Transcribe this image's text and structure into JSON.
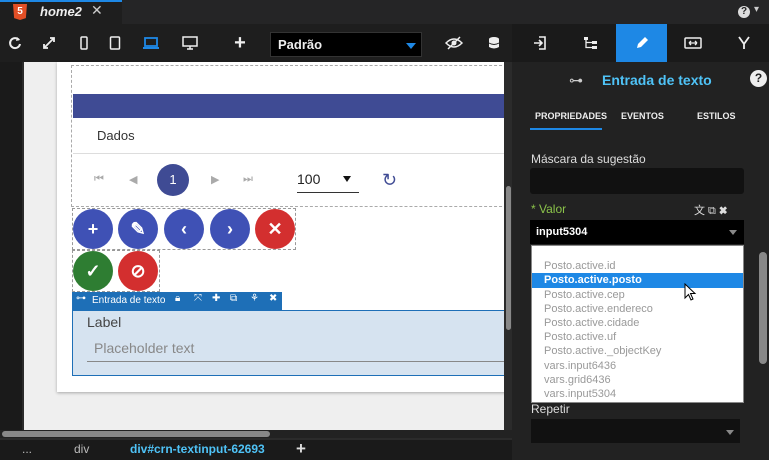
{
  "file_tab": {
    "icon_letter": "5",
    "name": "home2",
    "close": "✕"
  },
  "topbar": {
    "help": "?",
    "caret": "▾"
  },
  "toolbar": {
    "refresh": "⟳",
    "fullscreen": "⤢",
    "add": "+",
    "dropdown_value": "Padrão"
  },
  "canvas": {
    "tab_label": "Dados",
    "pagination": {
      "first": "⏮",
      "prev": "◀",
      "current": "1",
      "next": "▶",
      "last": "⏭",
      "per_page": "100",
      "refresh": "↻"
    },
    "fab_buttons": [
      {
        "name": "add",
        "glyph": "+",
        "color": "#3f51b5"
      },
      {
        "name": "edit",
        "glyph": "✎",
        "color": "#3f51b5"
      },
      {
        "name": "prev",
        "glyph": "‹",
        "color": "#3f51b5"
      },
      {
        "name": "next",
        "glyph": "›",
        "color": "#3f51b5"
      },
      {
        "name": "delete",
        "glyph": "✕",
        "color": "#d32f2f"
      },
      {
        "name": "confirm",
        "glyph": "✓",
        "color": "#2e7d32"
      },
      {
        "name": "cancel",
        "glyph": "⊘",
        "color": "#d32f2f"
      }
    ],
    "selected_component": {
      "label": "Entrada de texto"
    },
    "text_input": {
      "label": "Label",
      "placeholder": "Placeholder text"
    }
  },
  "breadcrumb": {
    "items": [
      "...",
      "div",
      "div#crn-textinput-62693"
    ],
    "add": "+"
  },
  "panel": {
    "title": "Entrada de texto",
    "help": "?",
    "subtabs": [
      "PROPRIEDADES",
      "EVENTOS",
      "ESTILOS"
    ],
    "mask_label": "Máscara da sugestão",
    "value_label": "* Valor",
    "value_icons": "文 ⧉ ✖",
    "value_selected": "input5304",
    "dropdown_options": [
      "Posto.active.id",
      "Posto.active.posto",
      "Posto.active.cep",
      "Posto.active.endereco",
      "Posto.active.cidade",
      "Posto.active.uf",
      "Posto.active._objectKey",
      "vars.input6436",
      "vars.grid6436",
      "vars.input5304"
    ],
    "highlighted_option": "Posto.active.posto",
    "repeat_label": "Repetir"
  },
  "colors": {
    "accent": "#1e88e5",
    "primary": "#3f51b5",
    "danger": "#d32f2f",
    "success": "#2e7d32",
    "value_label": "#8bc34a"
  }
}
